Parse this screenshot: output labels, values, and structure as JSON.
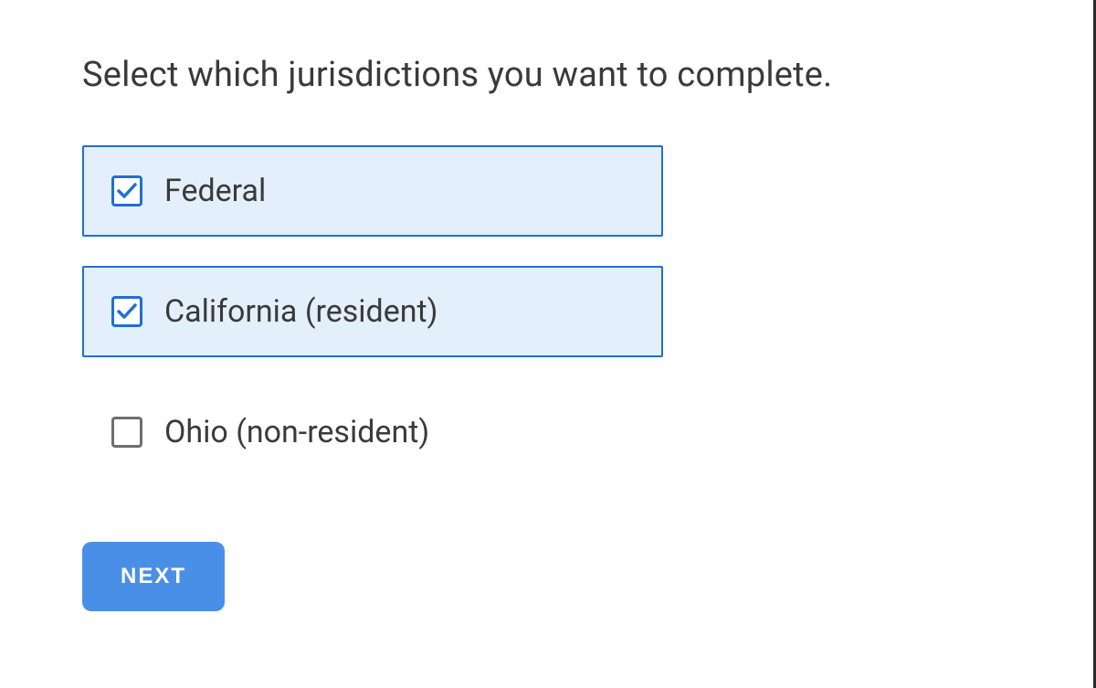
{
  "heading": "Select which jurisdictions you want to complete.",
  "options": [
    {
      "label": "Federal",
      "selected": true
    },
    {
      "label": "California (resident)",
      "selected": true
    },
    {
      "label": "Ohio (non-resident)",
      "selected": false
    }
  ],
  "nextButton": "NEXT"
}
